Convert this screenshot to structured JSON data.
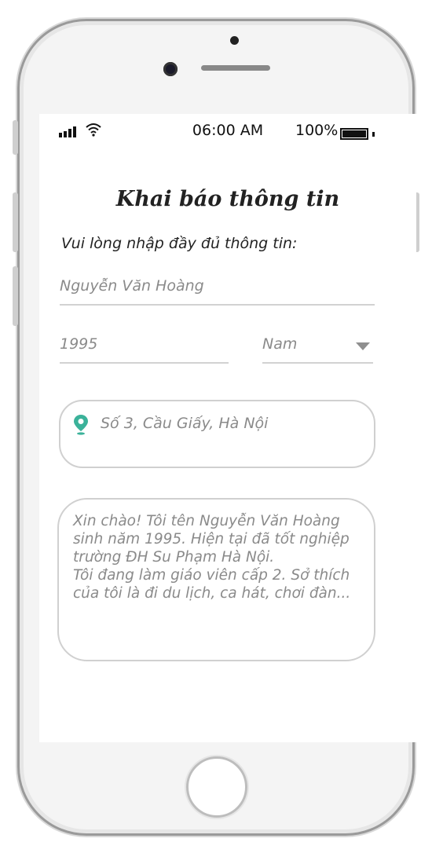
{
  "status_bar": {
    "time": "06:00 AM",
    "battery_percent": "100%",
    "battery_level": 100
  },
  "form": {
    "title": "Khai báo thông tin",
    "instruction": "Vui lòng nhập đầy đủ thông tin:",
    "name_value": "Nguyễn Văn Hoàng",
    "birth_year_value": "1995",
    "gender_value": "Nam",
    "address_value": "Số 3, Cầu Giấy, Hà Nội",
    "bio_value": "Xin chào! Tôi tên Nguyễn Văn Hoàng\nsinh năm 1995. Hiện tại đã tốt nghiệp\ntrường ĐH Su Phạm Hà Nội.\nTôi đang làm giáo viên cấp 2. Sở thích\ncủa tôi là đi du lịch, ca hát, chơi đàn..."
  },
  "colors": {
    "pin": "#3bb29a"
  }
}
